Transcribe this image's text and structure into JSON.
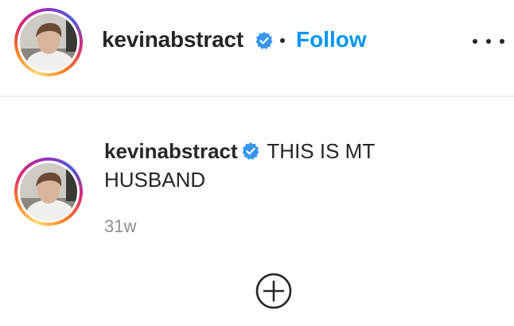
{
  "post_header": {
    "username": "kevinabstract",
    "verified_icon": "verified-badge-icon",
    "separator": "•",
    "follow_label": "Follow",
    "more_icon": "more-options-icon"
  },
  "comment": {
    "username": "kevinabstract",
    "text": "THIS IS MT HUSBAND",
    "time": "31w"
  },
  "load_more_icon": "plus-circle-icon",
  "colors": {
    "text": "#262626",
    "accent": "#0095f6",
    "muted": "#8e8e8e",
    "divider": "#efefef",
    "verified": "#3897f0"
  }
}
